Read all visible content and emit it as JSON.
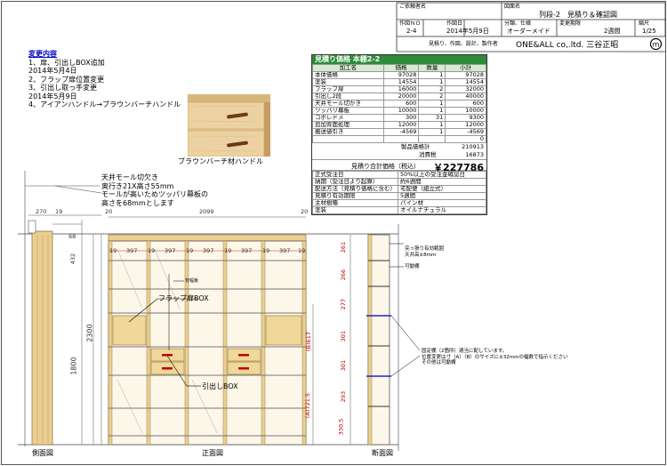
{
  "title_block": {
    "client_label": "ご依頼者名",
    "drawing_name_label": "図面名",
    "drawing_name": "列段-2　見積り＆確認図",
    "drawing_no_label": "作図ＮＯ",
    "drawing_no": "2-4",
    "date_label": "作図日",
    "date": "2014年5月9日",
    "category_label": "分類、仕様",
    "category": "オーダーメイド",
    "period_label": "変更期限",
    "period": "2週間",
    "scale_label": "縮尺",
    "scale": "1/25",
    "footer_label": "見積り、作図、設計、製作者",
    "company": "ONE&ALL co,.ltd. 三谷正昭"
  },
  "change_notes": {
    "title": "変更内容",
    "lines": [
      "1、扉、引出しBOX追加",
      "2014年5月4日",
      "2、フラップ扉位置変更",
      "3、引出し取っ手変更",
      "2014年5月9日",
      "4、アイアンハンドル→ブラウンバーチハンドル"
    ]
  },
  "photo_caption": "ブラウンバーチ材ハンドル",
  "estimate": {
    "header": "見積り価格 本棚2-2",
    "columns": [
      "加工名",
      "価格",
      "数量",
      "小計"
    ],
    "rows": [
      [
        "本体価格",
        "97028",
        "1",
        "97028"
      ],
      [
        "塗装",
        "14554",
        "1",
        "14554"
      ],
      [
        "フラップ扉",
        "16000",
        "2",
        "32000"
      ],
      [
        "引出し2段",
        "20000",
        "2",
        "40000"
      ],
      [
        "天井モール切かき",
        "600",
        "1",
        "600"
      ],
      [
        "ツッパリ幕板",
        "10000",
        "1",
        "10000"
      ],
      [
        "コボレドメ",
        "300",
        "31",
        "9300"
      ],
      [
        "追加背面処理",
        "12000",
        "1",
        "12000"
      ],
      [
        "搬送値引き",
        "-4569",
        "1",
        "-4569"
      ],
      [
        "",
        "",
        "",
        "0"
      ]
    ],
    "subtotal_label": "製品価格計",
    "subtotal": "210913",
    "tax_label": "消費税",
    "tax": "16873",
    "total_label": "見積り合計価格（税込）",
    "total": "￥227786",
    "conditions": [
      [
        "正式受注日",
        "50%以上の受注金確認日"
      ],
      [
        "納期（受注日より起算）",
        "約6週間"
      ],
      [
        "配送方法（見積り価格に含む）",
        "宅配便（組立式）"
      ],
      [
        "見積り有効期限",
        "5週間"
      ],
      [
        "主材樹種",
        "パイン材"
      ],
      [
        "塗装",
        "オイルナチュラル"
      ]
    ]
  },
  "annotations": {
    "ceiling_note": [
      "天井モール切欠き",
      "奥行き21X高さ55mm",
      "モールが高いためツッパリ幕板の",
      "高さを68mmとします"
    ],
    "flap_box": "フラップ扉BOX",
    "drawer_box": "引出しBOX",
    "back_panel": "背幅板",
    "top_note": [
      "突っ張り有効範囲",
      "天井高±8mm"
    ],
    "movable_shelf": "可動棚",
    "fixed_note": [
      "固定棚（2箇所）適当に配しています。",
      "位置変更は寸（A）（B）のサイズに±32mmの幅数で指示ください",
      "その他は可動棚"
    ]
  },
  "dimensions": {
    "side_width": "270",
    "side_gap": "19",
    "front_gap": "20",
    "total_width": "2099",
    "top_height": "68",
    "side_432": "432",
    "height_2300": "2300",
    "height_1800": "1800",
    "column_width": "397",
    "thickness": "19",
    "section_heights": [
      "261",
      "266",
      "277",
      "301",
      "301",
      "293",
      "330.5"
    ],
    "dim_a": "(A)721.5",
    "dim_b": "(B)617"
  },
  "view_labels": {
    "side": "側面図",
    "front": "正面図",
    "section": "断面図"
  }
}
